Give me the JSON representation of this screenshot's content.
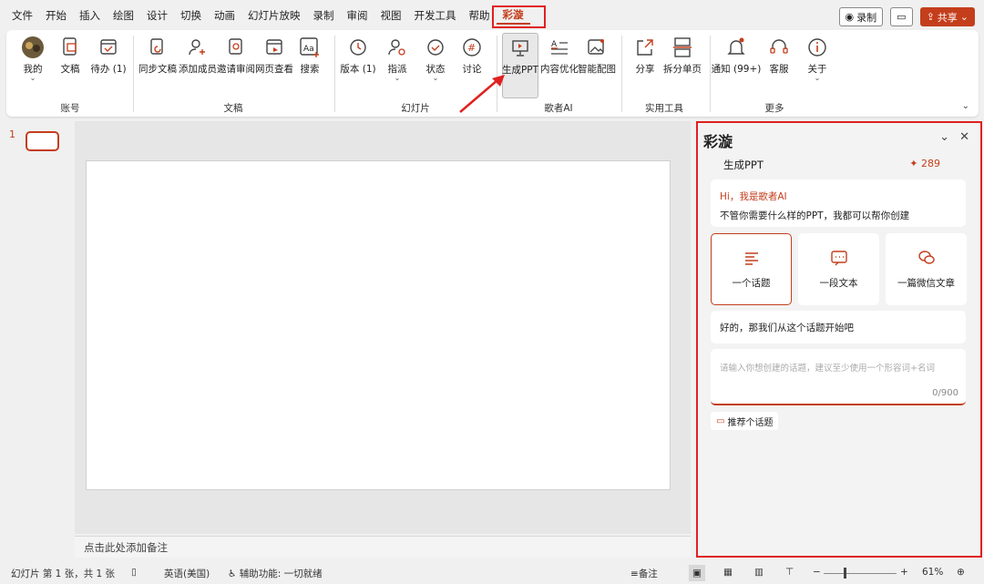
{
  "tabs": [
    "文件",
    "开始",
    "插入",
    "绘图",
    "设计",
    "切换",
    "动画",
    "幻灯片放映",
    "录制",
    "审阅",
    "视图",
    "开发工具",
    "帮助",
    "彩漩"
  ],
  "active_tab": "彩漩",
  "top_buttons": {
    "record": "录制",
    "share": "共享"
  },
  "ribbon": {
    "buttons": {
      "mine": "我的",
      "docs": "文稿",
      "todo": "待办 (1)",
      "sync": "同步文稿",
      "add_member": "添加成员",
      "invite_review": "邀请审阅",
      "web_view": "网页查看",
      "search": "搜索",
      "version": "版本 (1)",
      "assign": "指派",
      "status": "状态",
      "discuss": "讨论",
      "gen_ppt": "生成PPT",
      "content_opt": "内容优化",
      "smart_img": "智能配图",
      "share": "分享",
      "split": "拆分单页",
      "notify": "通知 (99+)",
      "service": "客服",
      "about": "关于"
    },
    "groups": {
      "account": "账号",
      "docs": "文稿",
      "slides": "幻灯片",
      "ai": "歌者AI",
      "tools": "实用工具",
      "more": "更多"
    }
  },
  "slides": {
    "number": "1"
  },
  "notes_placeholder": "点击此处添加备注",
  "panel": {
    "title": "彩漩",
    "subtitle": "生成PPT",
    "count": "289",
    "greeting": "Hi，我是歌者AI",
    "greeting_line2": "不管你需要什么样的PPT，我都可以帮你创建",
    "options": [
      "一个话题",
      "一段文本",
      "一篇微信文章"
    ],
    "reply": "好的，那我们从这个话题开始吧",
    "input_placeholder": "请输入你想创建的话题，建议至少使用一个形容词+名词",
    "char_count": "0/900",
    "recommend": "推荐个话题"
  },
  "statusbar": {
    "slide_info": "幻灯片 第 1 张，共 1 张",
    "language": "英语(美国)",
    "accessibility": "辅助功能: 一切就绪",
    "notes": "备注",
    "zoom": "61%"
  },
  "colors": {
    "accent": "#c43e1c",
    "highlight": "#e02020"
  }
}
